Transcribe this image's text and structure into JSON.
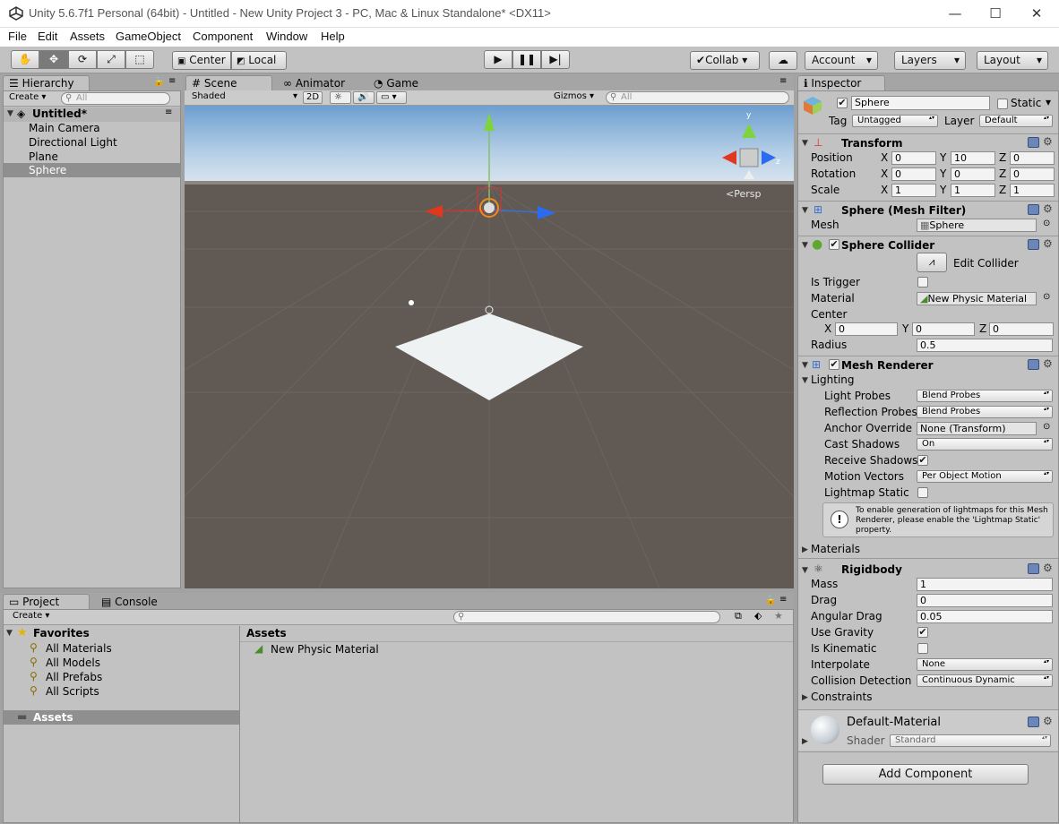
{
  "window": {
    "title": "Unity 5.6.7f1 Personal (64bit) - Untitled - New Unity Project 3 - PC, Mac & Linux Standalone* <DX11>"
  },
  "menu": [
    "File",
    "Edit",
    "Assets",
    "GameObject",
    "Component",
    "Window",
    "Help"
  ],
  "toolbar": {
    "center": "Center",
    "local": "Local",
    "collab": "Collab",
    "account": "Account",
    "layers": "Layers",
    "layout": "Layout"
  },
  "hierarchy": {
    "tab": "Hierarchy",
    "create": "Create",
    "search": "All",
    "scene": "Untitled*",
    "items": [
      "Main Camera",
      "Directional Light",
      "Plane",
      "Sphere"
    ],
    "selected": 3
  },
  "scene": {
    "tabs": [
      "Scene",
      "Animator",
      "Game"
    ],
    "shading": "Shaded",
    "mode2d": "2D",
    "gizmos": "Gizmos",
    "search": "All",
    "persp": "Persp",
    "axis_y": "y",
    "axis_z": "z"
  },
  "project": {
    "tabs": [
      "Project",
      "Console"
    ],
    "create": "Create",
    "favorites": "Favorites",
    "fav_items": [
      "All Materials",
      "All Models",
      "All Prefabs",
      "All Scripts"
    ],
    "assets_folder": "Assets",
    "assets_header": "Assets",
    "asset_items": [
      "New Physic Material"
    ]
  },
  "inspector": {
    "tab": "Inspector",
    "object": {
      "name": "Sphere",
      "static": "Static",
      "tag_label": "Tag",
      "tag": "Untagged",
      "layer_label": "Layer",
      "layer": "Default"
    },
    "transform": {
      "title": "Transform",
      "rows": [
        {
          "label": "Position",
          "x": "0",
          "y": "10",
          "z": "0"
        },
        {
          "label": "Rotation",
          "x": "0",
          "y": "0",
          "z": "0"
        },
        {
          "label": "Scale",
          "x": "1",
          "y": "1",
          "z": "1"
        }
      ]
    },
    "mesh_filter": {
      "title": "Sphere (Mesh Filter)",
      "mesh_label": "Mesh",
      "mesh": "Sphere"
    },
    "collider": {
      "title": "Sphere Collider",
      "edit": "Edit Collider",
      "trigger": "Is Trigger",
      "material_label": "Material",
      "material": "New Physic Material",
      "center": "Center",
      "cx": "0",
      "cy": "0",
      "cz": "0",
      "radius_label": "Radius",
      "radius": "0.5"
    },
    "renderer": {
      "title": "Mesh Renderer",
      "lighting": "Lighting",
      "rows": [
        {
          "label": "Light Probes",
          "value": "Blend Probes"
        },
        {
          "label": "Reflection Probes",
          "value": "Blend Probes"
        },
        {
          "label": "Anchor Override",
          "value": "None (Transform)"
        },
        {
          "label": "Cast Shadows",
          "value": "On"
        },
        {
          "label": "Receive Shadows",
          "value": ""
        },
        {
          "label": "Motion Vectors",
          "value": "Per Object Motion"
        },
        {
          "label": "Lightmap Static",
          "value": ""
        }
      ],
      "info": "To enable generation of lightmaps for this Mesh Renderer, please enable the 'Lightmap Static' property.",
      "materials": "Materials"
    },
    "rigidbody": {
      "title": "Rigidbody",
      "rows": [
        {
          "label": "Mass",
          "value": "1"
        },
        {
          "label": "Drag",
          "value": "0"
        },
        {
          "label": "Angular Drag",
          "value": "0.05"
        },
        {
          "label": "Use Gravity",
          "value": ""
        },
        {
          "label": "Is Kinematic",
          "value": ""
        },
        {
          "label": "Interpolate",
          "value": "None"
        },
        {
          "label": "Collision Detection",
          "value": "Continuous Dynamic"
        }
      ],
      "constraints": "Constraints"
    },
    "material": {
      "name": "Default-Material",
      "shader_label": "Shader",
      "shader": "Standard"
    },
    "add_component": "Add Component"
  }
}
